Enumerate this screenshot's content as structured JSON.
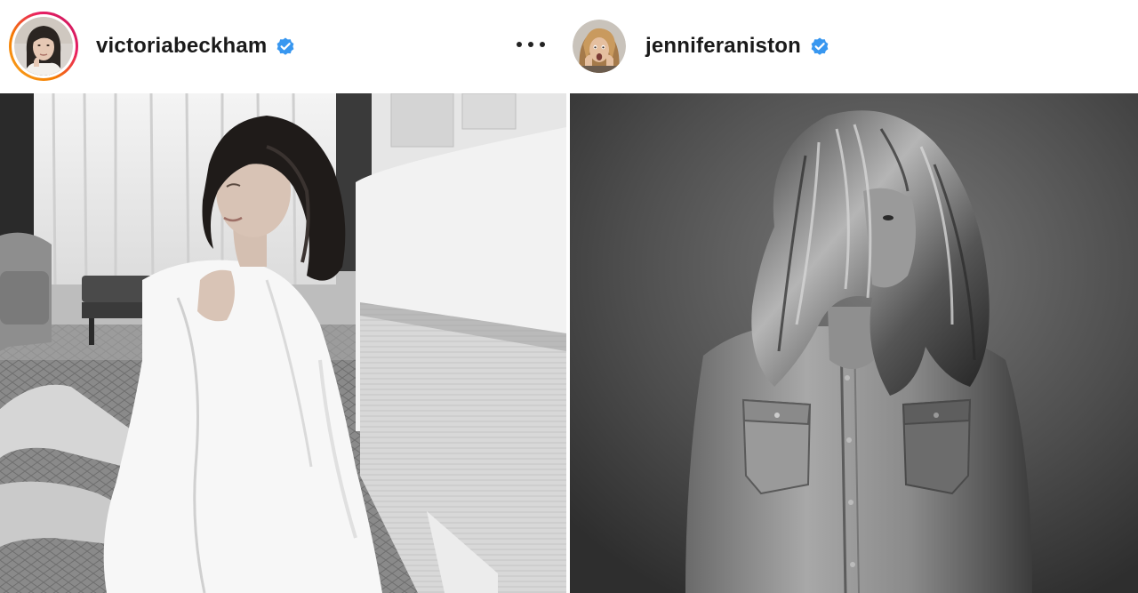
{
  "posts": [
    {
      "username": "victoriabeckham",
      "verified": true,
      "avatar_icon": "profile-photo-victoria",
      "has_story_ring": true,
      "photo_icon": "bw-photo-woman-white-shirt-by-bed"
    },
    {
      "username": "jenniferaniston",
      "verified": true,
      "avatar_icon": "profile-photo-jennifer",
      "has_story_ring": false,
      "photo_icon": "bw-photo-woman-denim-shirt"
    }
  ],
  "more_options_icon": "ellipsis-icon",
  "colors": {
    "verified_badge": "#3897f0",
    "story_ring_start": "#f9a825",
    "story_ring_end": "#c2185b",
    "username_text": "#1a1a1a"
  }
}
